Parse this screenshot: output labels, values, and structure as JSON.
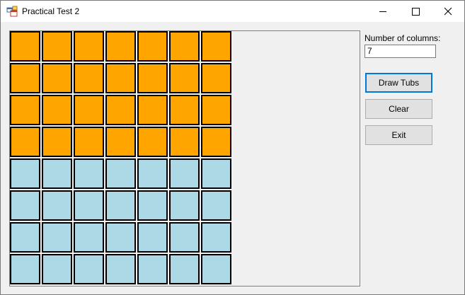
{
  "window": {
    "title": "Practical Test 2"
  },
  "titlebar_buttons": {
    "minimize": "minimize-icon",
    "maximize": "maximize-icon",
    "close": "close-icon"
  },
  "form": {
    "columns_label": "Number of columns:",
    "columns_value": "7",
    "buttons": {
      "draw": "Draw Tubs",
      "clear": "Clear",
      "exit": "Exit"
    }
  },
  "grid": {
    "columns": 7,
    "rows": [
      "orange",
      "orange",
      "orange",
      "orange",
      "lightblue",
      "lightblue",
      "lightblue",
      "lightblue"
    ],
    "colors": {
      "orange": "#ffa500",
      "lightblue": "#add8e6",
      "border": "#000000"
    }
  }
}
